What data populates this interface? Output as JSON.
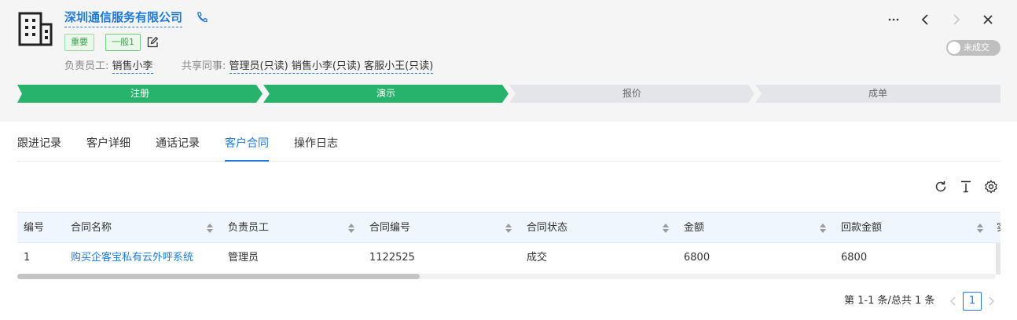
{
  "header": {
    "company_name": "深圳通信服务有限公司",
    "tags": {
      "important": "重要",
      "level": "一般1"
    },
    "owner_label": "负责员工:",
    "owner_value": "销售小李",
    "share_label": "共享同事:",
    "shared": [
      "管理员(只读)",
      "销售小李(只读)",
      "客服小王(只读)"
    ],
    "toggle_label": "未成交",
    "icons": [
      "building-icon",
      "phone-icon",
      "edit-icon",
      "more-icon",
      "prev-icon",
      "next-icon",
      "close-icon"
    ]
  },
  "stages": {
    "items": [
      {
        "label": "注册",
        "done": true
      },
      {
        "label": "演示",
        "done": true
      },
      {
        "label": "报价",
        "done": false
      },
      {
        "label": "成单",
        "done": false
      }
    ],
    "done_color": "#27b36b",
    "todo_color": "#e3e5e8"
  },
  "tabs": {
    "items": [
      "跟进记录",
      "客户详细",
      "通话记录",
      "客户合同",
      "操作日志"
    ],
    "active": "客户合同"
  },
  "toolbar": {
    "icons": [
      "refresh-icon",
      "export-icon",
      "settings-icon"
    ]
  },
  "table": {
    "columns": [
      "编号",
      "合同名称",
      "负责员工",
      "合同编号",
      "合同状态",
      "金额",
      "回款金额",
      "实"
    ],
    "rows": [
      [
        "1",
        "购买企客宝私有云外呼系统",
        "管理员",
        "1122525",
        "成交",
        "6800",
        "6800"
      ]
    ]
  },
  "pagination": {
    "summary": "第 1-1 条/总共 1 条",
    "current_page": "1"
  },
  "colors": {
    "accent": "#1f7ad8",
    "success": "#27b36b"
  }
}
